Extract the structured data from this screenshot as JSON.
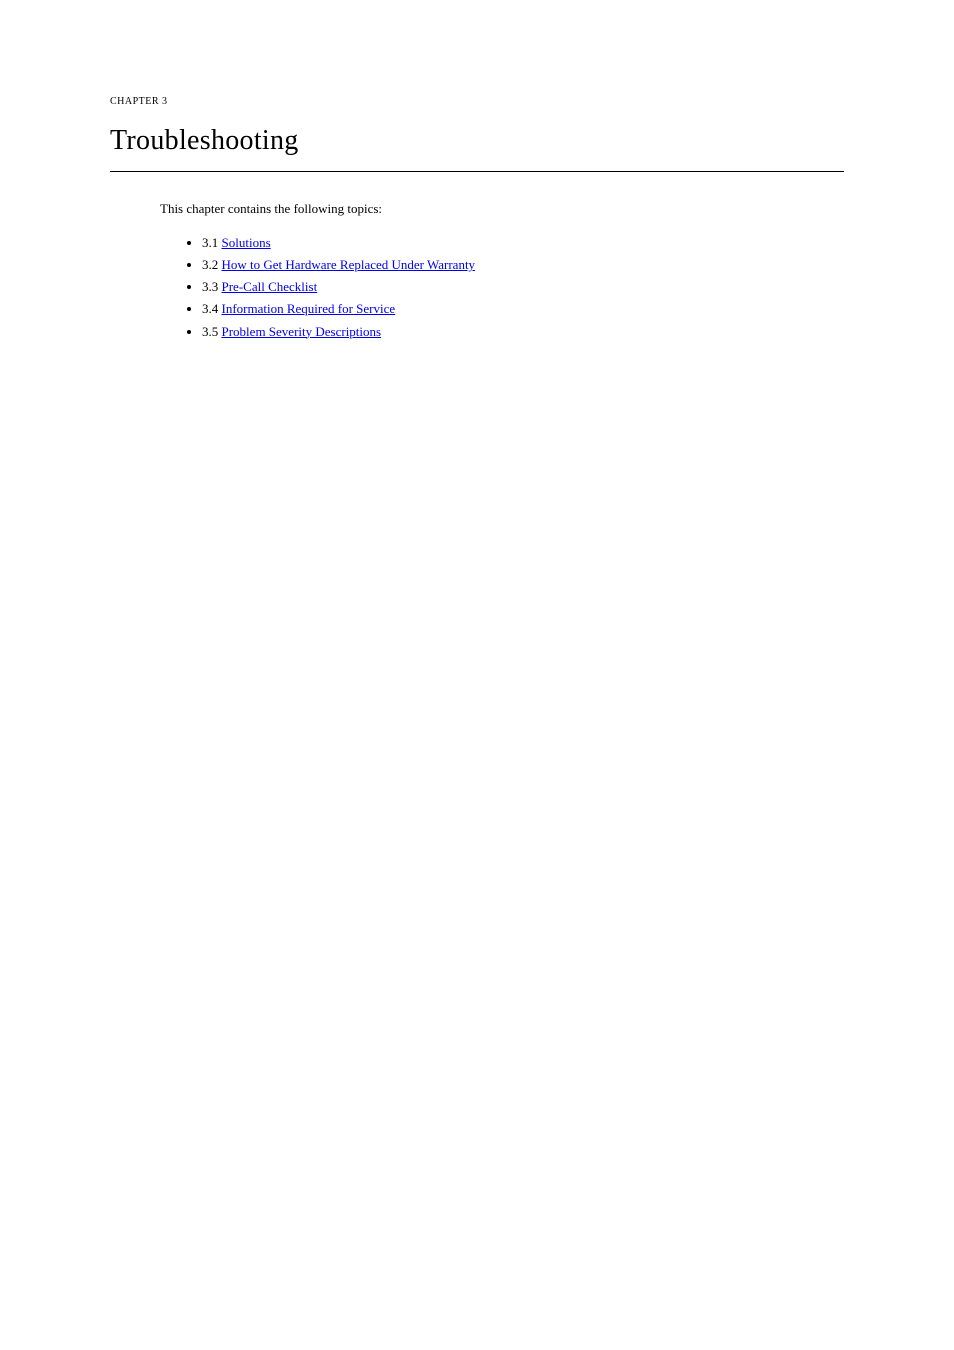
{
  "header": {
    "chapter_label": "CHAPTER 3",
    "chapter_title": "Troubleshooting"
  },
  "intro": "This chapter contains the following topics:",
  "links": [
    {
      "number": "3.1 ",
      "label": "Solutions"
    },
    {
      "number": "3.2 ",
      "label": "How to Get Hardware Replaced Under Warranty"
    },
    {
      "number": "3.3 ",
      "label": "Pre-Call Checklist"
    },
    {
      "number": "3.4 ",
      "label": "Information Required for Service"
    },
    {
      "number": "3.5 ",
      "label": "Problem Severity Descriptions"
    }
  ]
}
